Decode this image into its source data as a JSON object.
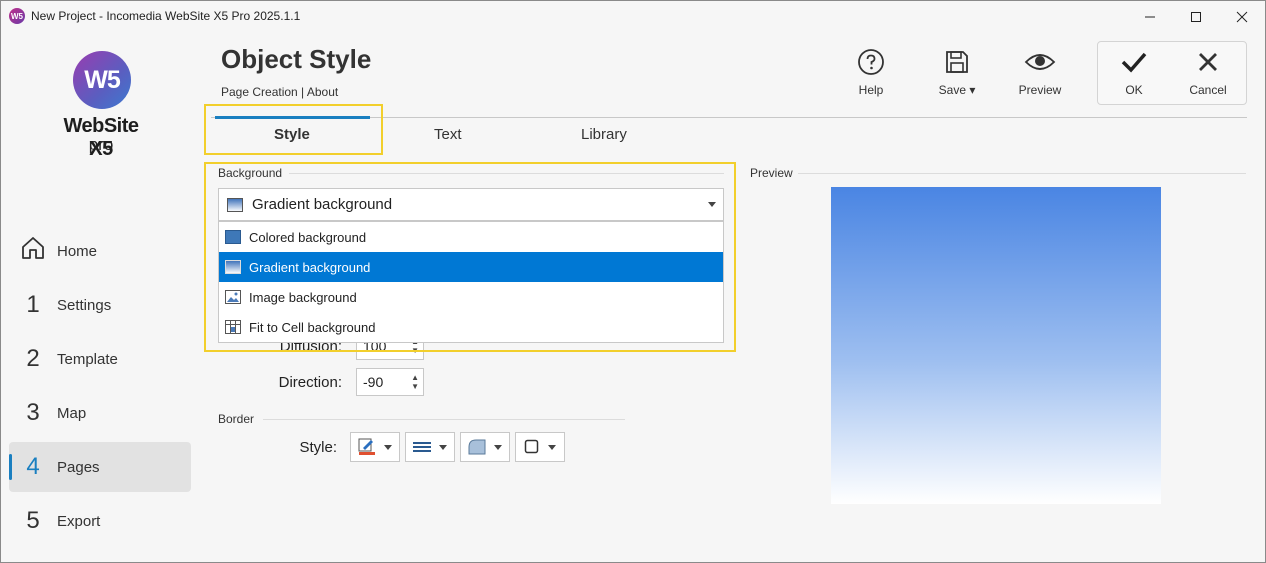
{
  "window": {
    "title": "New Project - Incomedia WebSite X5 Pro 2025.1.1"
  },
  "logo": {
    "mark": "W5",
    "name": "WebSite X5",
    "edition": "pro"
  },
  "nav": [
    {
      "num": "",
      "label": "Home",
      "icon": "home-icon"
    },
    {
      "num": "1",
      "label": "Settings"
    },
    {
      "num": "2",
      "label": "Template"
    },
    {
      "num": "3",
      "label": "Map"
    },
    {
      "num": "4",
      "label": "Pages",
      "active": true
    },
    {
      "num": "5",
      "label": "Export"
    }
  ],
  "header": {
    "title": "Object Style",
    "breadcrumb": "Page Creation | About"
  },
  "toolbar": {
    "help": "Help",
    "save": "Save",
    "preview": "Preview",
    "ok": "OK",
    "cancel": "Cancel"
  },
  "tabs": [
    "Style",
    "Text",
    "Library"
  ],
  "background": {
    "section_label": "Background",
    "selected": "Gradient background",
    "options": [
      "Colored background",
      "Gradient background",
      "Image background",
      "Fit to Cell background"
    ]
  },
  "fields": {
    "diffusion_label": "Diffusion:",
    "diffusion_value": "100",
    "direction_label": "Direction:",
    "direction_value": "-90"
  },
  "border": {
    "section_label": "Border",
    "style_label": "Style:"
  },
  "preview": {
    "label": "Preview"
  },
  "colors": {
    "accent": "#1a7fc0",
    "selection": "#0078d4",
    "highlight": "#f2cf2c",
    "gradient_top": "#4a85e3",
    "gradient_bottom": "#ffffff"
  }
}
